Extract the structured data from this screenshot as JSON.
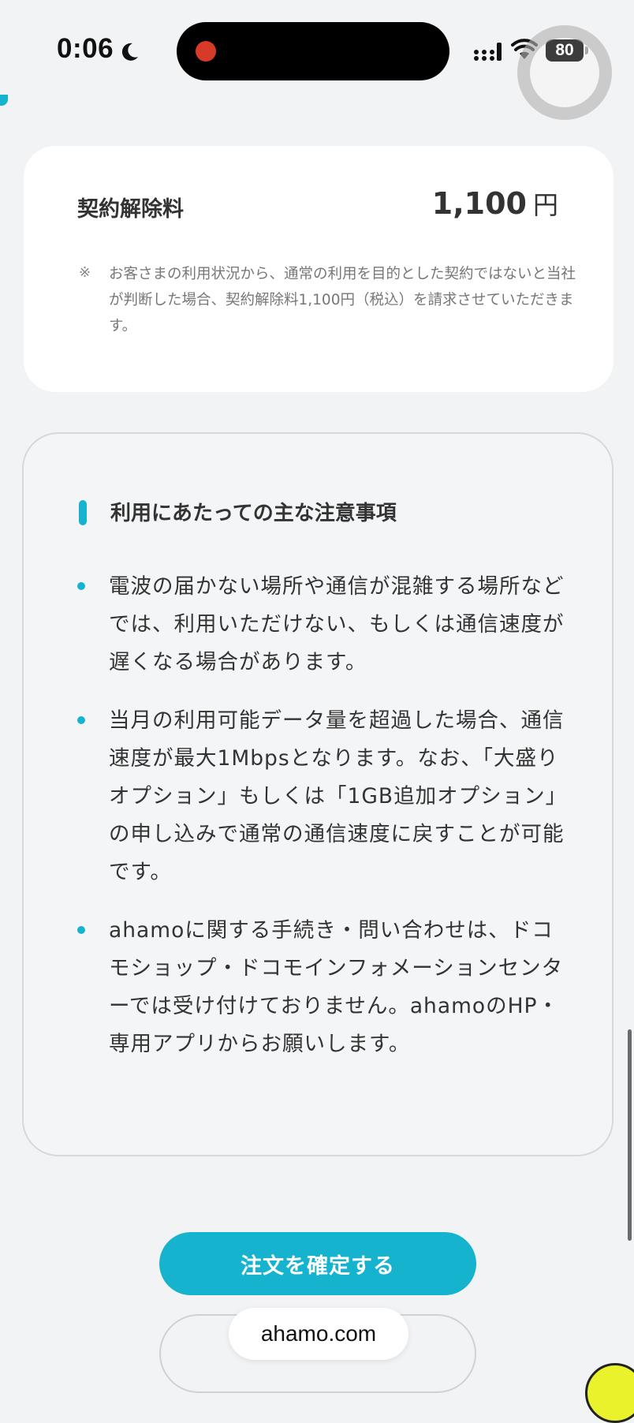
{
  "status_bar": {
    "time": "0:06",
    "battery": "80",
    "icons": [
      "moon-icon",
      "signal-icon",
      "wifi-icon",
      "battery-icon"
    ]
  },
  "fee_card": {
    "label": "契約解除料",
    "amount": "1,100",
    "unit": "円",
    "note_mark": "※",
    "note": "お客さまの利用状況から、通常の利用を目的とした契約ではないと当社が判断した場合、契約解除料1,100円（税込）を請求させていただきます。"
  },
  "caution": {
    "title": "利用にあたっての主な注意事項",
    "items": [
      "電波の届かない場所や通信が混雑する場所などでは、利用いただけない、もしくは通信速度が遅くなる場合があります。",
      "当月の利用可能データ量を超過した場合、通信速度が最大1Mbpsとなります。なお、「大盛りオプション」もしくは「1GB追加オプション」の申し込みで通常の通信速度に戻すことが可能です。",
      "ahamoに関する手続き・問い合わせは、ドコモショップ・ドコモインフォメーションセンターでは受け付けておりません。ahamoのHP・専用アプリからお願いします。"
    ]
  },
  "actions": {
    "confirm_label": "注文を確定する"
  },
  "browser": {
    "url": "ahamo.com"
  },
  "colors": {
    "accent": "#16b3cf",
    "background": "#f2f3f4",
    "card": "#ffffff",
    "text": "#333333"
  }
}
